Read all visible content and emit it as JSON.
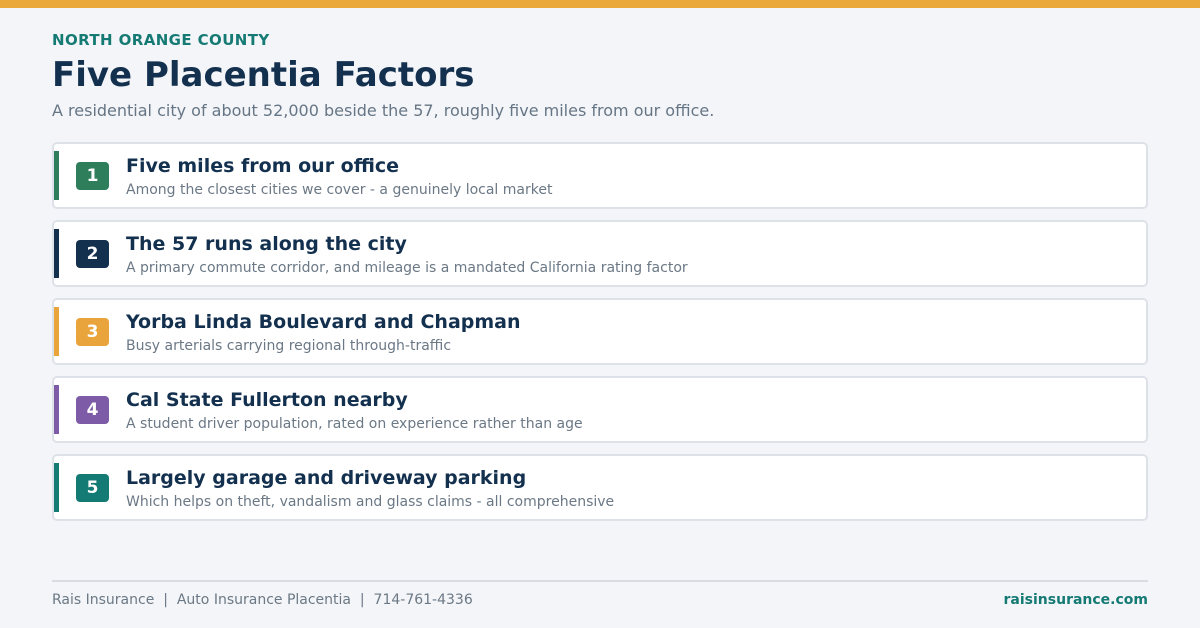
{
  "header": {
    "eyebrow": "NORTH ORANGE COUNTY",
    "title": "Five Placentia Factors",
    "subtitle": "A residential city of about 52,000 beside the 57, roughly five miles from our office."
  },
  "factors": [
    {
      "number": "1",
      "title": "Five miles from our office",
      "description": "Among the closest cities we cover - a genuinely local market",
      "color": "#2e7d5b"
    },
    {
      "number": "2",
      "title": "The 57 runs along the city",
      "description": "A primary commute corridor, and mileage is a mandated California rating factor",
      "color": "#13304f"
    },
    {
      "number": "3",
      "title": "Yorba Linda Boulevard and Chapman",
      "description": "Busy arterials carrying regional through-traffic",
      "color": "#e9a43c"
    },
    {
      "number": "4",
      "title": "Cal State Fullerton nearby",
      "description": "A student driver population, rated on experience rather than age",
      "color": "#7d5ba6"
    },
    {
      "number": "5",
      "title": "Largely garage and driveway parking",
      "description": "Which helps on theft, vandalism and glass claims - all comprehensive",
      "color": "#137a74"
    }
  ],
  "footer": {
    "company": "Rais Insurance",
    "separator": "|",
    "page": "Auto Insurance Placentia",
    "phone": "714-761-4336",
    "website": "raisinsurance.com"
  },
  "colors": {
    "top_bar": "#eba83a",
    "eyebrow": "#157a74",
    "title": "#13304f",
    "website": "#157a74"
  }
}
